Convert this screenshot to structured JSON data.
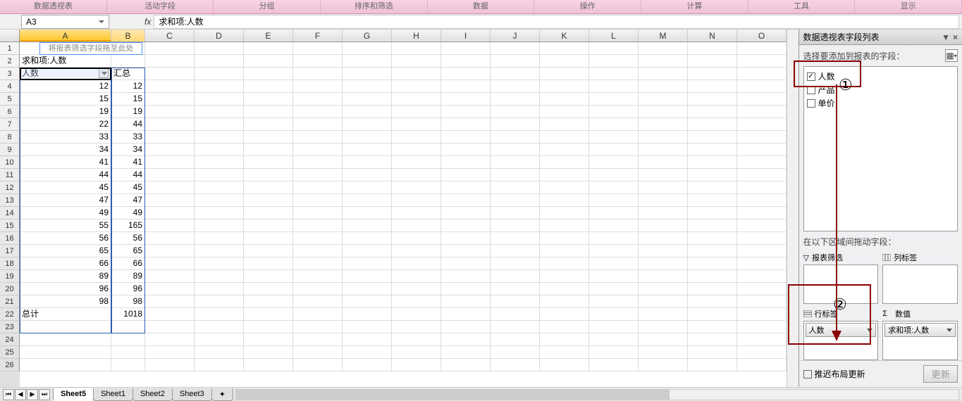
{
  "ribbon": {
    "tabs": [
      "数据透视表",
      "活动字段",
      "分组",
      "排序和筛选",
      "数据",
      "操作",
      "计算",
      "工具",
      "显示"
    ]
  },
  "namebox": "A3",
  "fx": "fx",
  "formula": "求和项:人数",
  "columns": [
    "A",
    "B",
    "C",
    "D",
    "E",
    "F",
    "G",
    "H",
    "I",
    "J",
    "K",
    "L",
    "M",
    "N",
    "O"
  ],
  "pivot_drag_hint": "将报表筛选字段拖至此处",
  "pivot": {
    "a3": "求和项:人数",
    "a4": "人数",
    "b4": "汇总",
    "total_label": "总计",
    "total_value": "1018",
    "rows": [
      {
        "a": "12",
        "b": "12"
      },
      {
        "a": "15",
        "b": "15"
      },
      {
        "a": "19",
        "b": "19"
      },
      {
        "a": "22",
        "b": "44"
      },
      {
        "a": "33",
        "b": "33"
      },
      {
        "a": "34",
        "b": "34"
      },
      {
        "a": "41",
        "b": "41"
      },
      {
        "a": "44",
        "b": "44"
      },
      {
        "a": "45",
        "b": "45"
      },
      {
        "a": "47",
        "b": "47"
      },
      {
        "a": "49",
        "b": "49"
      },
      {
        "a": "55",
        "b": "165"
      },
      {
        "a": "56",
        "b": "56"
      },
      {
        "a": "65",
        "b": "65"
      },
      {
        "a": "66",
        "b": "66"
      },
      {
        "a": "89",
        "b": "89"
      },
      {
        "a": "96",
        "b": "96"
      },
      {
        "a": "98",
        "b": "98"
      }
    ]
  },
  "field_panel": {
    "title": "数据透视表字段列表",
    "instruction": "选择要添加到报表的字段：",
    "fields": [
      {
        "name": "人数",
        "checked": true
      },
      {
        "name": "产品",
        "checked": false
      },
      {
        "name": "单价",
        "checked": false
      }
    ],
    "drag_instruction": "在以下区域间拖动字段：",
    "areas": {
      "filter": "报表筛选",
      "columns": "列标签",
      "rows": "行标签",
      "values": "数值",
      "sigma": "Σ"
    },
    "row_item": "人数",
    "value_item": "求和项:人数",
    "defer": "推迟布局更新",
    "update": "更新"
  },
  "sheets": [
    "Sheet5",
    "Sheet1",
    "Sheet2",
    "Sheet3"
  ],
  "annotations": {
    "circle1": "①",
    "circle2": "②"
  }
}
